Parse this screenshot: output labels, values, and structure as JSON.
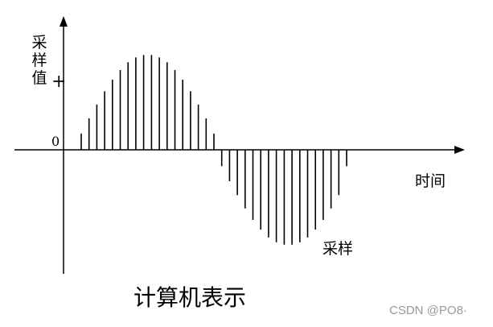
{
  "labels": {
    "y_axis": "采样值",
    "plus_mark": "+",
    "zero_mark": "0",
    "x_axis": "时间",
    "samples": "采样",
    "caption": "计算机表示",
    "watermark": "CSDN @PO8·"
  },
  "colors": {
    "ink": "#000000",
    "watermark": "#9a9a9a",
    "background": "#ffffff"
  },
  "samples": {
    "count": 35,
    "amplitudes": [
      0.27,
      0.52,
      0.75,
      0.97,
      1.16,
      1.32,
      1.45,
      1.53,
      1.57,
      1.57,
      1.53,
      1.45,
      1.32,
      1.16,
      0.97,
      0.75,
      0.52,
      0.27,
      -0.27,
      -0.52,
      -0.75,
      -0.97,
      -1.16,
      -1.32,
      -1.45,
      -1.53,
      -1.57,
      -1.57,
      -1.53,
      -1.45,
      -1.32,
      -1.16,
      -0.97,
      -0.75,
      -0.27
    ]
  }
}
